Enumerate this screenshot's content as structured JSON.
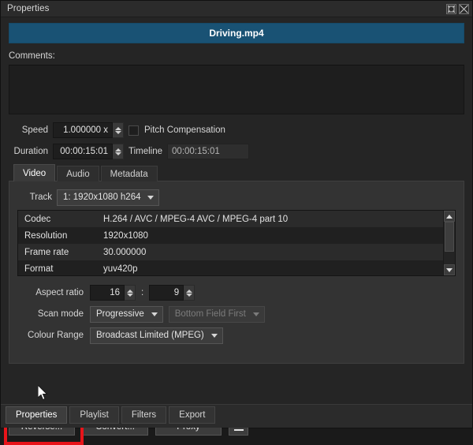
{
  "window": {
    "title": "Properties",
    "float_icon": "float-window-icon",
    "close_icon": "close-icon"
  },
  "file_header": {
    "name": "Driving.mp4",
    "accent_color": "#195274"
  },
  "comments": {
    "label": "Comments:",
    "value": "",
    "placeholder": ""
  },
  "speed": {
    "label": "Speed",
    "value": "1.000000 x",
    "pitch_compensation_label": "Pitch Compensation",
    "pitch_compensation_checked": false
  },
  "duration": {
    "label": "Duration",
    "value": "00:00:15:01",
    "timeline_label": "Timeline",
    "timeline_value": "00:00:15:01"
  },
  "tabs": [
    {
      "label": "Video",
      "active": true
    },
    {
      "label": "Audio",
      "active": false
    },
    {
      "label": "Metadata",
      "active": false
    }
  ],
  "track": {
    "label": "Track",
    "value": "1: 1920x1080 h264"
  },
  "properties_table": {
    "rows": [
      {
        "key": "Codec",
        "value": "H.264 / AVC / MPEG-4 AVC / MPEG-4 part 10"
      },
      {
        "key": "Resolution",
        "value": "1920x1080"
      },
      {
        "key": "Frame rate",
        "value": "30.000000"
      },
      {
        "key": "Format",
        "value": "yuv420p"
      }
    ]
  },
  "aspect_ratio": {
    "label": "Aspect ratio",
    "numerator": "16",
    "separator": ":",
    "denominator": "9"
  },
  "scan_mode": {
    "label": "Scan mode",
    "value": "Progressive",
    "field_order_value": "Bottom Field First",
    "field_order_disabled": true
  },
  "colour_range": {
    "label": "Colour Range",
    "value": "Broadcast Limited (MPEG)"
  },
  "actions": {
    "reverse": "Reverse...",
    "convert": "Convert...",
    "proxy": "Proxy",
    "menu_icon": "hamburger-menu-icon",
    "highlight_color": "#e8141a"
  },
  "bottom_tabs": [
    {
      "label": "Properties",
      "active": true
    },
    {
      "label": "Playlist",
      "active": false
    },
    {
      "label": "Filters",
      "active": false
    },
    {
      "label": "Export",
      "active": false
    }
  ]
}
